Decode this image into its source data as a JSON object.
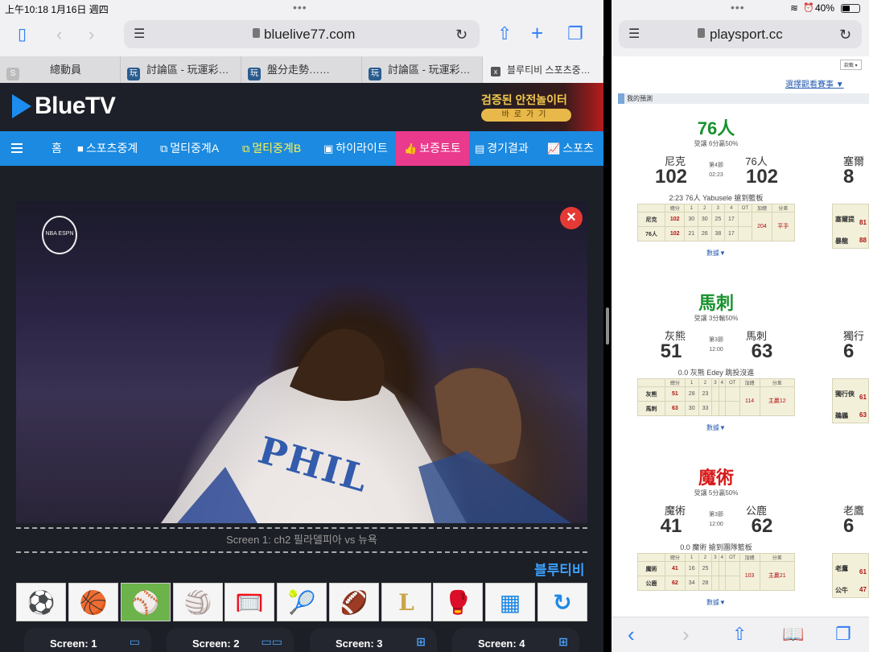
{
  "left": {
    "status": {
      "time": "上午10:18  1月16日 週四"
    },
    "url": "bluelive77.com",
    "tabs": [
      {
        "label": "總動員",
        "icon": "S"
      },
      {
        "label": "討論區 - 玩運彩…",
        "icon": "玩"
      },
      {
        "label": "盤分走勢……",
        "icon": "玩"
      },
      {
        "label": "討論區 - 玩運彩…",
        "icon": "玩"
      },
      {
        "label": "블루티비 스포츠중…",
        "icon": "x"
      }
    ],
    "site": {
      "logo": "BlueTV",
      "promo_line1": "검증된 안전놀이터",
      "promo_line2": "바로가기"
    },
    "nav": [
      {
        "label": "홈"
      },
      {
        "label": "스포츠중계"
      },
      {
        "label": "멀티중계A"
      },
      {
        "label": "멀티중계B"
      },
      {
        "label": "하이라이트"
      },
      {
        "label": "보증토토"
      },
      {
        "label": "경기결과"
      },
      {
        "label": "스포츠"
      }
    ],
    "video": {
      "logo_text": "NBA ESPN",
      "jersey_text": "PHIL",
      "close": "×"
    },
    "caption": "Screen 1: ch2 필라델피아 vs 뉴욕",
    "brand_text": "블루티비",
    "sports_icons": [
      {
        "name": "soccer-icon",
        "glyph": "⚽"
      },
      {
        "name": "basketball-icon",
        "glyph": "🏀"
      },
      {
        "name": "baseball-icon",
        "glyph": "⚾"
      },
      {
        "name": "volleyball-icon",
        "glyph": "🏐"
      },
      {
        "name": "hockey-icon",
        "glyph": "🥅"
      },
      {
        "name": "tennis-icon",
        "glyph": "🎾"
      },
      {
        "name": "football-icon",
        "glyph": "🏈"
      },
      {
        "name": "lol-icon",
        "glyph": "L"
      },
      {
        "name": "boxing-icon",
        "glyph": "🥊"
      },
      {
        "name": "monitor-icon",
        "glyph": "▦"
      },
      {
        "name": "refresh-icon",
        "glyph": "↻"
      }
    ],
    "screens": [
      {
        "label": "Screen: 1"
      },
      {
        "label": "Screen: 2"
      },
      {
        "label": "Screen: 3"
      },
      {
        "label": "Screen: 4"
      }
    ]
  },
  "right": {
    "status": {
      "battery": "40%"
    },
    "url": "playsport.cc",
    "select_label": "款載 ▾",
    "choose_link": "選擇觀看賽事 ▼",
    "section": "我的預測",
    "games": [
      {
        "pick": "76人",
        "pick_color": "#17922e",
        "sub": "受讓 6分贏50%",
        "away": "尼克",
        "home": "76人",
        "away_score": "102",
        "home_score": "102",
        "period": "第4節",
        "clock": "02:23",
        "info": "2:23 76人 Yabusele 搶到籃板",
        "rows": [
          {
            "team": "尼克",
            "tot": "102",
            "q": [
              "30",
              "30",
              "25",
              "17",
              ""
            ],
            "sum": "204",
            "res": "平手"
          },
          {
            "team": "76人",
            "tot": "102",
            "q": [
              "21",
              "26",
              "38",
              "17",
              ""
            ],
            "sum": "",
            "res": ""
          }
        ],
        "more": "數據▼",
        "side": {
          "away": "塞爾",
          "score": "8",
          "t1": "塞爾提",
          "v1": "81",
          "t2": "暴龍",
          "v2": "88"
        }
      },
      {
        "pick": "馬刺",
        "pick_color": "#17922e",
        "sub": "受讓 3分輸50%",
        "away": "灰熊",
        "home": "馬刺",
        "away_score": "51",
        "home_score": "63",
        "period": "第3節",
        "clock": "12:00",
        "info": "0.0 灰熊 Edey 跳投沒進",
        "rows": [
          {
            "team": "灰熊",
            "tot": "51",
            "q": [
              "28",
              "23",
              "",
              "",
              ""
            ],
            "sum": "114",
            "res": "主贏12"
          },
          {
            "team": "馬刺",
            "tot": "63",
            "q": [
              "30",
              "33",
              "",
              "",
              ""
            ],
            "sum": "",
            "res": ""
          }
        ],
        "more": "數據▼",
        "side": {
          "away": "獨行",
          "score": "6",
          "t1": "獨行俠",
          "v1": "61",
          "t2": "鵜鶘",
          "v2": "63"
        }
      },
      {
        "pick": "魔術",
        "pick_color": "#d81a1a",
        "sub": "受讓 5分贏50%",
        "away": "魔術",
        "home": "公鹿",
        "away_score": "41",
        "home_score": "62",
        "period": "第3節",
        "clock": "12:00",
        "info": "0.0 魔術 搶到團隊籃板",
        "rows": [
          {
            "team": "魔術",
            "tot": "41",
            "q": [
              "16",
              "25",
              "",
              "",
              ""
            ],
            "sum": "103",
            "res": "主贏21"
          },
          {
            "team": "公鹿",
            "tot": "62",
            "q": [
              "34",
              "28",
              "",
              "",
              ""
            ],
            "sum": "",
            "res": ""
          }
        ],
        "more": "數據▼",
        "side": {
          "away": "老鷹",
          "score": "6",
          "t1": "老鷹",
          "v1": "61",
          "t2": "公牛",
          "v2": "47"
        }
      }
    ],
    "box_headers": [
      "總分",
      "1",
      "2",
      "3",
      "4",
      "OT",
      "加總",
      "分差"
    ]
  }
}
